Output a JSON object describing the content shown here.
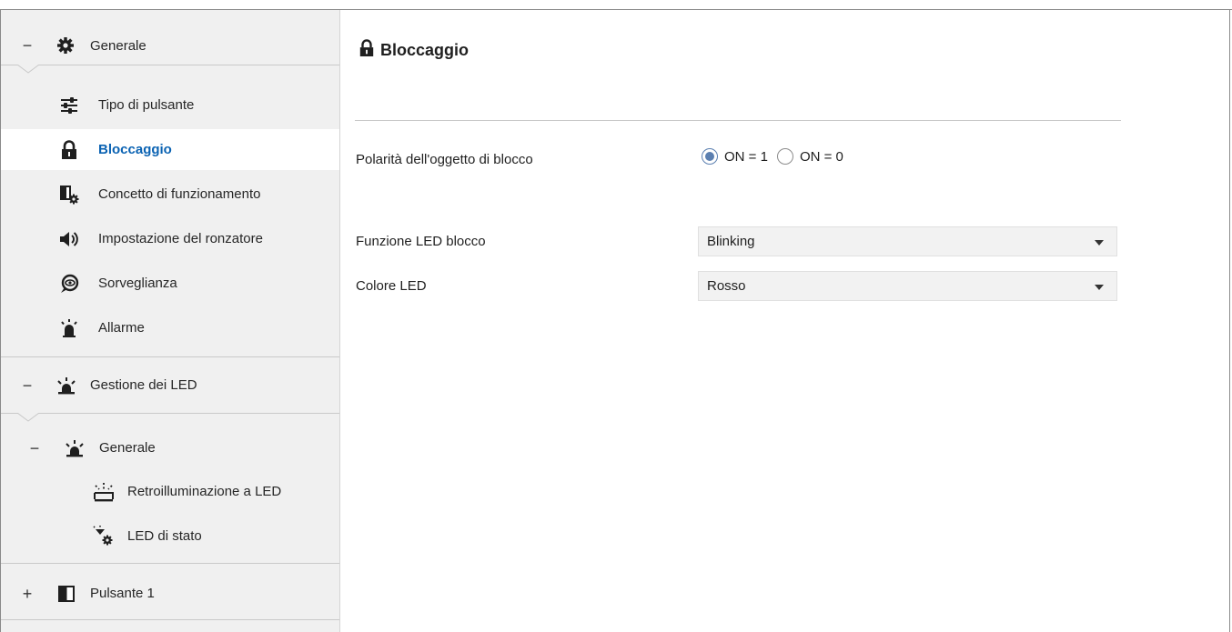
{
  "sidebar": {
    "items": [
      {
        "sign": "−",
        "icon": "gear-icon",
        "label": "Generale"
      },
      {
        "icon": "sliders-icon",
        "label": "Tipo di pulsante"
      },
      {
        "icon": "lock-icon",
        "label": "Bloccaggio",
        "active": true
      },
      {
        "icon": "panel-gear-icon",
        "label": "Concetto di funzionamento"
      },
      {
        "icon": "speaker-icon",
        "label": "Impostazione del ronzatore"
      },
      {
        "icon": "eye-bubble-icon",
        "label": "Sorveglianza"
      },
      {
        "icon": "alarm-icon",
        "label": "Allarme"
      },
      {
        "sign": "−",
        "icon": "led-icon",
        "label": "Gestione dei LED"
      },
      {
        "sign": "−",
        "icon": "led-icon",
        "label": "Generale"
      },
      {
        "icon": "backlight-icon",
        "label": "Retroilluminazione a LED"
      },
      {
        "icon": "status-led-icon",
        "label": "LED di stato"
      },
      {
        "sign": "+",
        "icon": "button-panel-icon",
        "label": "Pulsante 1"
      }
    ]
  },
  "main": {
    "title": "Bloccaggio",
    "polarity": {
      "label": "Polarità dell'oggetto di blocco",
      "options": [
        "ON = 1",
        "ON = 0"
      ],
      "selected": "ON = 1"
    },
    "led_function": {
      "label": "Funzione LED blocco",
      "value": "Blinking"
    },
    "led_color": {
      "label": "Colore LED",
      "value": "Rosso"
    }
  },
  "colors": {
    "accent": "#0b63b3",
    "sidebar_bg": "#f0f0f0",
    "radio_selected": "#5b7fb0"
  }
}
